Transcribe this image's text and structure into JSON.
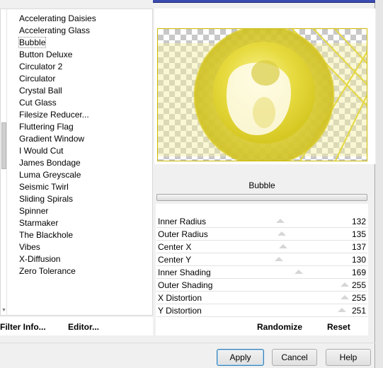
{
  "filters": {
    "items": [
      "Accelerating Daisies",
      "Accelerating Glass",
      "Bubble",
      "Button Deluxe",
      "Circulator 2",
      "Circulator",
      "Crystal Ball",
      "Cut Glass",
      "Filesize Reducer...",
      "Fluttering Flag",
      "Gradient Window",
      "I Would Cut",
      "James Bondage",
      "Luma Greyscale",
      "Seismic Twirl",
      "Sliding Spirals",
      "Spinner",
      "Starmaker",
      "The Blackhole",
      "Vibes",
      "X-Diffusion",
      "Zero Tolerance"
    ],
    "selected": "Bubble"
  },
  "effect": {
    "name": "Bubble"
  },
  "params": [
    {
      "label": "Inner Radius",
      "value": "132",
      "level": 0.52
    },
    {
      "label": "Outer Radius",
      "value": "135",
      "level": 0.53
    },
    {
      "label": "Center X",
      "value": "137",
      "level": 0.54
    },
    {
      "label": "Center Y",
      "value": "130",
      "level": 0.51
    },
    {
      "label": "Inner Shading",
      "value": "169",
      "level": 0.66
    },
    {
      "label": "Outer Shading",
      "value": "255",
      "level": 1.0
    },
    {
      "label": "X Distortion",
      "value": "255",
      "level": 1.0
    },
    {
      "label": "Y Distortion",
      "value": "251",
      "level": 0.98
    }
  ],
  "footer": {
    "filter_info_label": "Filter Info...",
    "editor_label": "Editor...",
    "randomize_label": "Randomize",
    "reset_label": "Reset"
  },
  "buttons": {
    "apply": "Apply",
    "cancel": "Cancel",
    "help": "Help"
  },
  "colors": {
    "bubble": "#e8dc40",
    "bubble_dark": "#c9b800",
    "title_bar": "#3b4bb0"
  }
}
